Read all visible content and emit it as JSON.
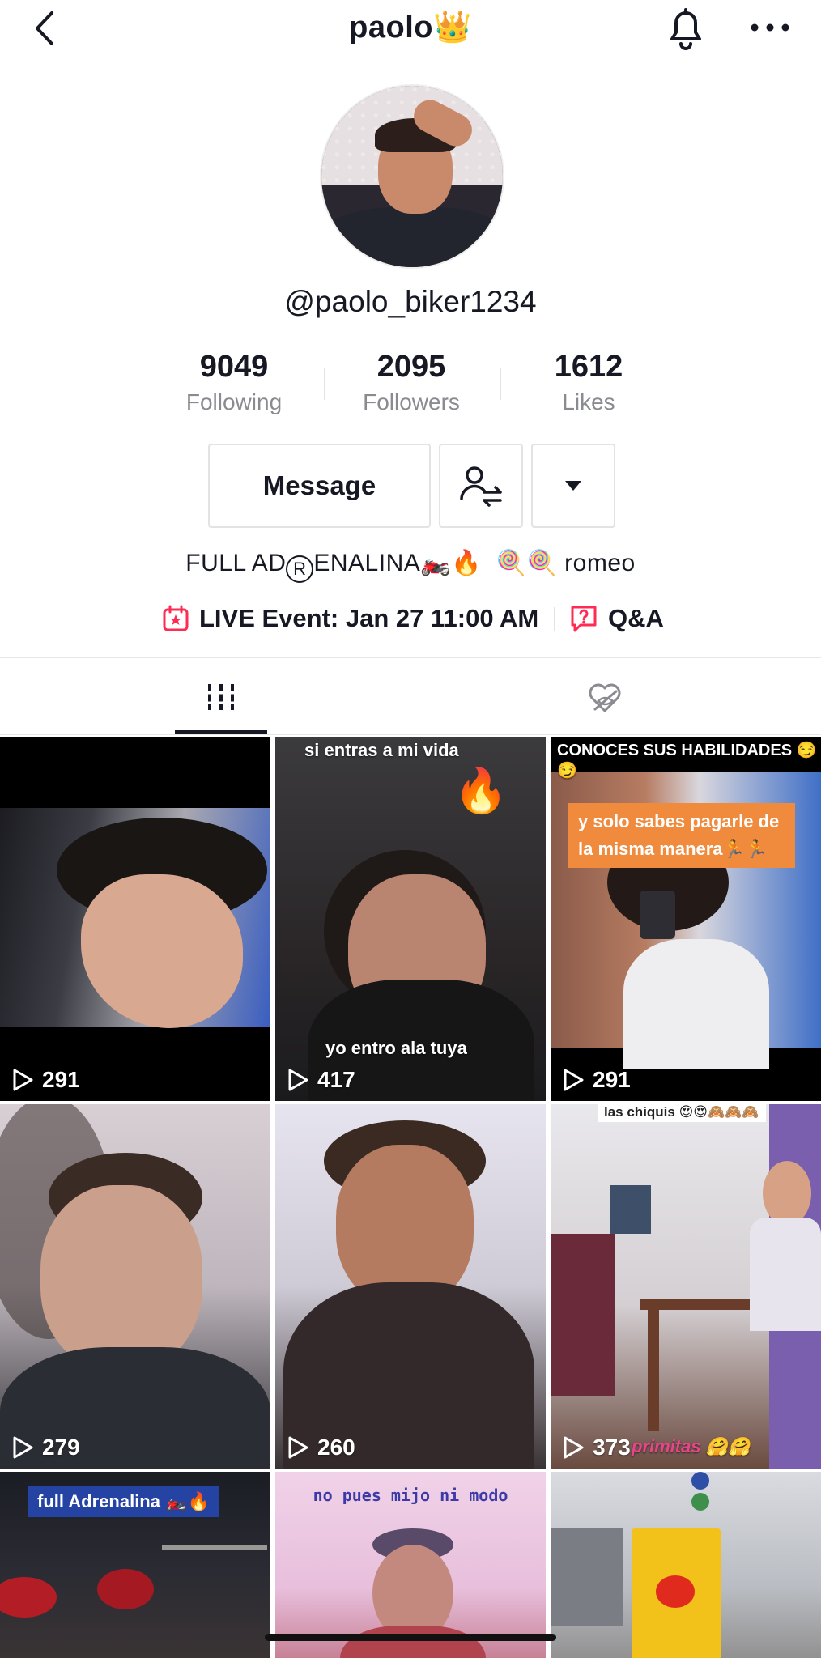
{
  "nav": {
    "title": "paolo👑"
  },
  "profile": {
    "handle": "@paolo_biker1234"
  },
  "stats": [
    {
      "value": "9049",
      "label": "Following"
    },
    {
      "value": "2095",
      "label": "Followers"
    },
    {
      "value": "1612",
      "label": "Likes"
    }
  ],
  "actions": {
    "message_label": "Message"
  },
  "bio": {
    "part1": "FULL AD",
    "reg": "R",
    "part2": "ENALINA🏍️🔥",
    "part3": "🍭🍭 romeo"
  },
  "events": {
    "live_label": "LIVE Event: Jan 27 11:00 AM",
    "qa_label": "Q&A"
  },
  "accent_color": "#fe2c55",
  "videos": [
    {
      "views": "291"
    },
    {
      "views": "417",
      "caption_top": "si entras a mi vida",
      "caption_bottom": "yo entro ala tuya"
    },
    {
      "views": "291",
      "caption_top": "CONOCES SUS HABILIDADES 😏😏",
      "caption_box": "y solo sabes pagarle de la misma manera🏃🏃"
    },
    {
      "views": "279"
    },
    {
      "views": "260"
    },
    {
      "views": "373",
      "caption_top": "las chiquis 😍😍🙈🙈🙈",
      "caption_bottom": "primitas 🤗🤗"
    },
    {
      "caption_box": "full Adrenalina 🏍️🔥"
    },
    {
      "caption_top": "no pues mijo ni modo"
    },
    {}
  ]
}
